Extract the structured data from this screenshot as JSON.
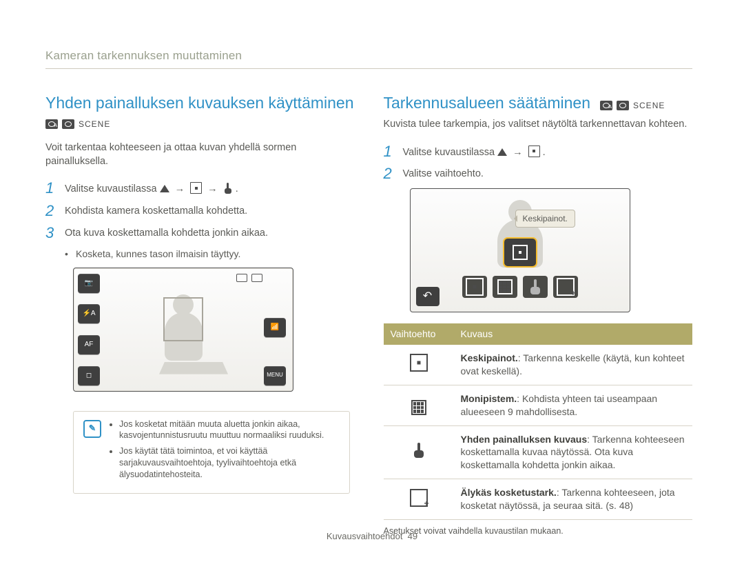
{
  "breadcrumb": "Kameran tarkennuksen muuttaminen",
  "left": {
    "heading": "Yhden painalluksen kuvauksen käyttäminen",
    "lead": "Voit tarkentaa kohteeseen ja ottaa kuvan yhdellä sormen painalluksella.",
    "step1_prefix": "Valitse kuvaustilassa ",
    "step1_suffix": ".",
    "step2": "Kohdista kamera koskettamalla kohdetta.",
    "step3": "Ota kuva koskettamalla kohdetta jonkin aikaa.",
    "step3_bullet": "Kosketa, kunnes tason ilmaisin täyttyy.",
    "lcd_left_labels": [
      "📷",
      "⚡A",
      "AF",
      "◻"
    ],
    "lcd_right_labels": [
      "📶",
      "MENU"
    ],
    "note1": "Jos kosketat mitään muuta aluetta jonkin aikaa, kasvojentunnistusruutu muuttuu normaaliksi ruuduksi.",
    "note2": "Jos käytät tätä toimintoa, et voi käyttää sarjakuvausvaihtoehtoja, tyylivaihtoehtoja etkä älysuodatintehosteita."
  },
  "right": {
    "heading": "Tarkennusalueen säätäminen",
    "lead": "Kuvista tulee tarkempia, jos valitset näytöltä tarkennettavan kohteen.",
    "step1_prefix": "Valitse kuvaustilassa ",
    "step1_suffix": ".",
    "step2": "Valitse vaihtoehto.",
    "tooltip": "Keskipainot.",
    "table_header_option": "Vaihtoehto",
    "table_header_desc": "Kuvaus",
    "rows": [
      {
        "term": "Keskipainot.",
        "desc": ": Tarkenna keskelle (käytä, kun kohteet ovat keskellä)."
      },
      {
        "term": "Monipistem.",
        "desc": ": Kohdista yhteen tai useampaan alueeseen 9 mahdollisesta."
      },
      {
        "term": "Yhden painalluksen kuvaus",
        "desc": ": Tarkenna kohteeseen koskettamalla kuvaa näytössä. Ota kuva koskettamalla kohdetta jonkin aikaa."
      },
      {
        "term": "Älykäs kosketustark.",
        "desc": ": Tarkenna kohteeseen, jota kosketat näytössä, ja seuraa sitä. (s. 48)"
      }
    ],
    "footnote": "Asetukset voivat vaihdella kuvaustilan mukaan."
  },
  "footer": {
    "section": "Kuvausvaihtoehdot",
    "page": "49"
  }
}
